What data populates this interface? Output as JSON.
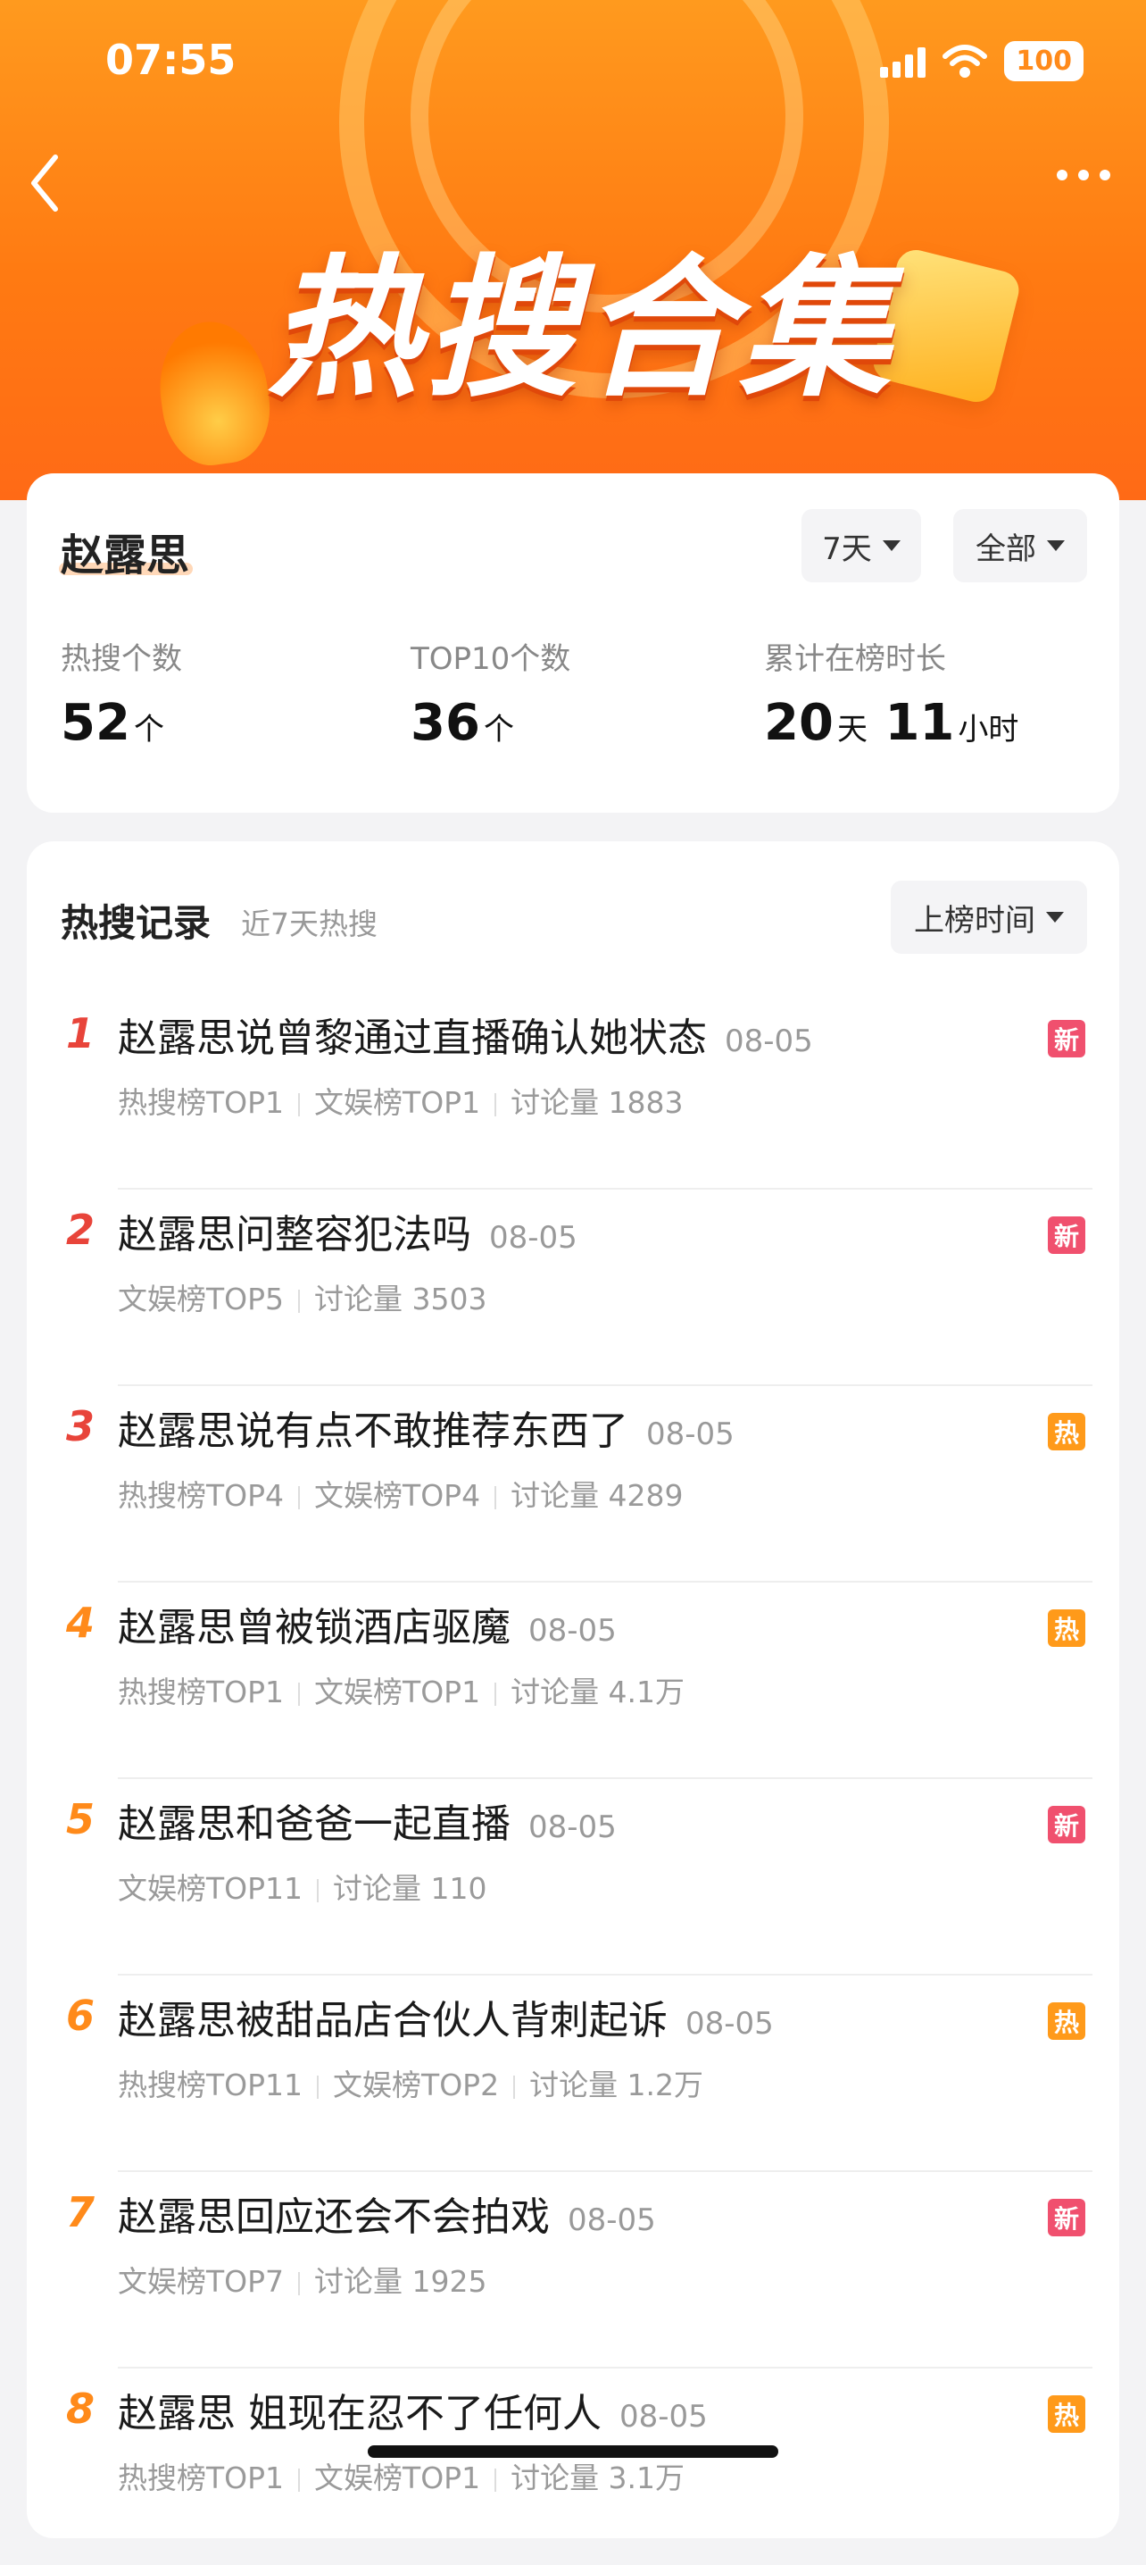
{
  "status": {
    "time": "07:55",
    "battery": "100"
  },
  "hero": {
    "title": "热搜合集"
  },
  "summary": {
    "name": "赵露思",
    "filter_days": "7天",
    "filter_scope": "全部",
    "stats": [
      {
        "label": "热搜个数",
        "value": "52",
        "unit": "个"
      },
      {
        "label": "TOP10个数",
        "value": "36",
        "unit": "个"
      },
      {
        "label": "累计在榜时长",
        "value1": "20",
        "unit1": "天",
        "value2": "11",
        "unit2": "小时"
      }
    ]
  },
  "records": {
    "title": "热搜记录",
    "subtitle": "近7天热搜",
    "sort_label": "上榜时间",
    "items": [
      {
        "rank": "1",
        "title": "赵露思说曾黎通过直播确认她状态",
        "date": "08-05",
        "meta": [
          "热搜榜TOP1",
          "文娱榜TOP1",
          "讨论量 1883"
        ],
        "badge": "新",
        "badge_color": "#f0506e",
        "rank_color": "#e8443a"
      },
      {
        "rank": "2",
        "title": "赵露思问整容犯法吗",
        "date": "08-05",
        "meta": [
          "文娱榜TOP5",
          "讨论量 3503"
        ],
        "badge": "新",
        "badge_color": "#f0506e",
        "rank_color": "#e8443a"
      },
      {
        "rank": "3",
        "title": "赵露思说有点不敢推荐东西了",
        "date": "08-05",
        "meta": [
          "热搜榜TOP4",
          "文娱榜TOP4",
          "讨论量 4289"
        ],
        "badge": "热",
        "badge_color": "#ff9a1a",
        "rank_color": "#e8443a"
      },
      {
        "rank": "4",
        "title": "赵露思曾被锁酒店驱魔",
        "date": "08-05",
        "meta": [
          "热搜榜TOP1",
          "文娱榜TOP1",
          "讨论量 4.1万"
        ],
        "badge": "热",
        "badge_color": "#ff9a1a",
        "rank_color": "#ff8a1a"
      },
      {
        "rank": "5",
        "title": "赵露思和爸爸一起直播",
        "date": "08-05",
        "meta": [
          "文娱榜TOP11",
          "讨论量 110"
        ],
        "badge": "新",
        "badge_color": "#f0506e",
        "rank_color": "#ff8a1a"
      },
      {
        "rank": "6",
        "title": "赵露思被甜品店合伙人背刺起诉",
        "date": "08-05",
        "meta": [
          "热搜榜TOP11",
          "文娱榜TOP2",
          "讨论量 1.2万"
        ],
        "badge": "热",
        "badge_color": "#ff9a1a",
        "rank_color": "#ff8a1a"
      },
      {
        "rank": "7",
        "title": "赵露思回应还会不会拍戏",
        "date": "08-05",
        "meta": [
          "文娱榜TOP7",
          "讨论量 1925"
        ],
        "badge": "新",
        "badge_color": "#f0506e",
        "rank_color": "#ff8a1a"
      },
      {
        "rank": "8",
        "title": "赵露思 姐现在忍不了任何人",
        "date": "08-05",
        "meta": [
          "热搜榜TOP1",
          "文娱榜TOP1",
          "讨论量 3.1万"
        ],
        "badge": "热",
        "badge_color": "#ff9a1a",
        "rank_color": "#ff8a1a"
      }
    ]
  }
}
